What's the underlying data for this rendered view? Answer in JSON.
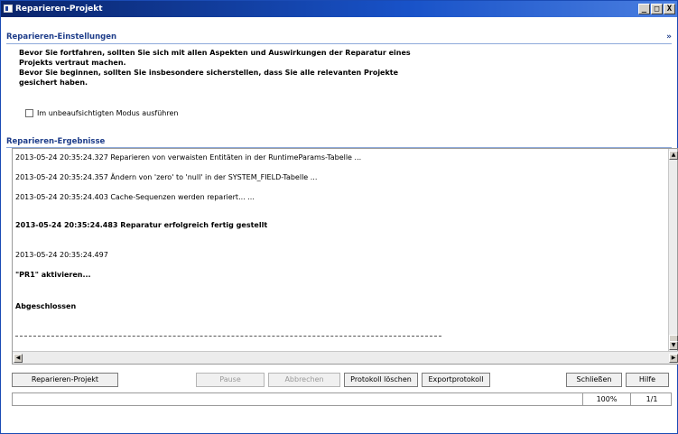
{
  "window": {
    "title": "Reparieren-Projekt",
    "controls": [
      "_",
      "□",
      "X"
    ]
  },
  "settings": {
    "header": "Reparieren-Einstellungen",
    "collapse_symbol": "»",
    "info_lines": [
      "Bevor Sie fortfahren, sollten Sie sich mit allen Aspekten und Auswirkungen der Reparatur eines",
      "Projekts vertraut machen.",
      "Bevor Sie beginnen, sollten Sie insbesondere sicherstellen, dass Sie alle relevanten Projekte",
      "gesichert haben."
    ],
    "unattended_label": "Im unbeaufsichtigten Modus ausführen",
    "unattended_checked": false
  },
  "results": {
    "header": "Reparieren-Ergebnisse",
    "log": [
      {
        "text": "2013-05-24 20:35:24.327   Reparieren von verwaisten Entitäten in der RuntimeParams-Tabelle ...",
        "bold": false
      },
      {
        "text": "2013-05-24 20:35:24.357   Ändern von 'zero' to 'null' in der SYSTEM_FIELD-Tabelle ...",
        "bold": false
      },
      {
        "text": "2013-05-24 20:35:24.403   Cache-Sequenzen werden repariert... ...",
        "bold": false
      },
      {
        "text": "2013-05-24 20:35:24.483  Reparatur erfolgreich fertig gestellt",
        "bold": true
      },
      {
        "text": "2013-05-24 20:35:24.497",
        "bold": false
      },
      {
        "text": "\"PR1\" aktivieren...",
        "bold": true
      },
      {
        "text": "Abgeschlossen",
        "bold": true
      }
    ]
  },
  "buttons": {
    "repair": "Reparieren-Projekt",
    "pause": "Pause",
    "cancel": "Abbrechen",
    "clear_log": "Protokoll löschen",
    "export_log": "Exportprotokoll",
    "close": "Schließen",
    "help": "Hilfe"
  },
  "status": {
    "message": "",
    "percent": "100%",
    "count": "1/1"
  }
}
